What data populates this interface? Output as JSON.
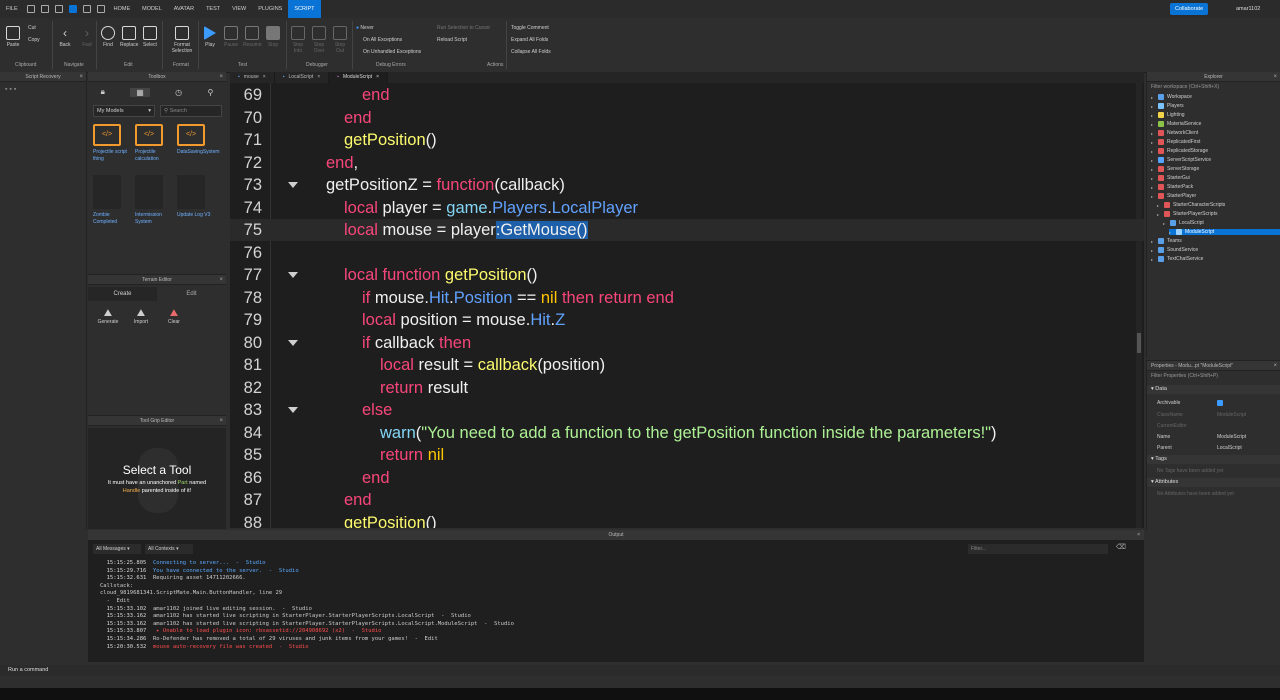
{
  "menu": {
    "items": [
      "FILE",
      "HOME",
      "MODEL",
      "AVATAR",
      "TEST",
      "VIEW",
      "PLUGINS",
      "SCRIPT"
    ],
    "active": "SCRIPT",
    "collaborate": "Collaborate",
    "user": "amar1102"
  },
  "ribbon": {
    "paste": "Paste",
    "cut": "Cut",
    "copy": "Copy",
    "back": "Back",
    "fwd": "Fwd",
    "find": "Find",
    "replace": "Replace",
    "select": "Select",
    "format": "Format Selection",
    "play": "Play",
    "pause": "Pause",
    "resume": "Resume",
    "stop": "Stop",
    "step_into": "Step Into",
    "step_over": "Step Over",
    "step_out": "Step Out",
    "never": "Never",
    "on_all": "On All Exceptions",
    "on_unhandled": "On Unhandled Exceptions",
    "reload": "Reload Script",
    "toggle_comment": "Toggle Comment",
    "expand": "Expand All Folds",
    "collapse": "Collapse All Folds",
    "groups": [
      "Clipboard",
      "Navigate",
      "Edit",
      "Format",
      "Test",
      "Debugger",
      "Debug Errors",
      "Actions"
    ]
  },
  "script_recovery": {
    "title": "Script Recovery"
  },
  "toolbox": {
    "title": "Toolbox",
    "dropdown": "My Models",
    "search_placeholder": "Search",
    "items": [
      "Projectile script thing",
      "Projectile calculation",
      "DataSavingSystem",
      "Zombie Completed",
      "Intermission System",
      "Update Log V3"
    ]
  },
  "terrain": {
    "title": "Terrain Editor",
    "tabs": [
      "Create",
      "Edit"
    ],
    "tools": [
      "Generate",
      "Import",
      "Clear"
    ]
  },
  "toolgrip": {
    "title": "Tool Grip Editor",
    "heading": "Select a Tool",
    "msg_a": "It must have an unanchored",
    "part": "Part",
    "msg_b": "named",
    "handle": "Handle",
    "msg_c": "parented inside of it!"
  },
  "tabs": [
    "mouse",
    "LocalScript",
    "ModuleScript"
  ],
  "active_tab": "ModuleScript",
  "code_lines": [
    {
      "n": "69",
      "fold": false,
      "indent": 3,
      "tokens": [
        [
          "kw",
          "end"
        ]
      ]
    },
    {
      "n": "70",
      "fold": false,
      "indent": 2,
      "tokens": [
        [
          "kw",
          "end"
        ]
      ]
    },
    {
      "n": "71",
      "fold": false,
      "indent": 2,
      "tokens": [
        [
          "fn",
          "getPosition"
        ],
        [
          "tx",
          "()"
        ]
      ]
    },
    {
      "n": "72",
      "fold": false,
      "indent": 1,
      "tokens": [
        [
          "kw",
          "end"
        ],
        [
          "tx",
          ","
        ]
      ]
    },
    {
      "n": "73",
      "fold": true,
      "indent": 1,
      "tokens": [
        [
          "tx",
          "getPositionZ = "
        ],
        [
          "kw",
          "function"
        ],
        [
          "tx",
          "(callback)"
        ]
      ]
    },
    {
      "n": "74",
      "fold": false,
      "indent": 2,
      "tokens": [
        [
          "kw",
          "local"
        ],
        [
          "tx",
          " player = "
        ],
        [
          "bi",
          "game"
        ],
        [
          "tx",
          "."
        ],
        [
          "pr",
          "Players"
        ],
        [
          "tx",
          "."
        ],
        [
          "pr",
          "LocalPlayer"
        ]
      ]
    },
    {
      "n": "75",
      "fold": false,
      "indent": 2,
      "highlight": true,
      "tokens": [
        [
          "kw",
          "local"
        ],
        [
          "tx",
          " mouse = player"
        ],
        [
          "sel",
          ":GetMouse()"
        ]
      ]
    },
    {
      "n": "76",
      "fold": false,
      "indent": 0,
      "tokens": []
    },
    {
      "n": "77",
      "fold": true,
      "indent": 2,
      "tokens": [
        [
          "kw",
          "local function "
        ],
        [
          "fn",
          "getPosition"
        ],
        [
          "tx",
          "()"
        ]
      ]
    },
    {
      "n": "78",
      "fold": false,
      "indent": 3,
      "tokens": [
        [
          "kw",
          "if"
        ],
        [
          "tx",
          " mouse."
        ],
        [
          "pr",
          "Hit"
        ],
        [
          "tx",
          "."
        ],
        [
          "pr",
          "Position"
        ],
        [
          "tx",
          " == "
        ],
        [
          "nl",
          "nil"
        ],
        [
          "kw",
          " then return end"
        ]
      ]
    },
    {
      "n": "79",
      "fold": false,
      "indent": 3,
      "tokens": [
        [
          "kw",
          "local"
        ],
        [
          "tx",
          " position = mouse."
        ],
        [
          "pr",
          "Hit"
        ],
        [
          "tx",
          "."
        ],
        [
          "pr",
          "Z"
        ]
      ]
    },
    {
      "n": "80",
      "fold": true,
      "indent": 3,
      "tokens": [
        [
          "kw",
          "if"
        ],
        [
          "tx",
          " callback "
        ],
        [
          "kw",
          "then"
        ]
      ]
    },
    {
      "n": "81",
      "fold": false,
      "indent": 4,
      "tokens": [
        [
          "kw",
          "local"
        ],
        [
          "tx",
          " result = "
        ],
        [
          "fn",
          "callback"
        ],
        [
          "tx",
          "(position)"
        ]
      ]
    },
    {
      "n": "82",
      "fold": false,
      "indent": 4,
      "tokens": [
        [
          "kw",
          "return"
        ],
        [
          "tx",
          " result"
        ]
      ]
    },
    {
      "n": "83",
      "fold": true,
      "indent": 3,
      "tokens": [
        [
          "kw",
          "else"
        ]
      ]
    },
    {
      "n": "84",
      "fold": false,
      "indent": 4,
      "tokens": [
        [
          "bi",
          "warn"
        ],
        [
          "tx",
          "("
        ],
        [
          "st",
          "\"You need to add a function to the getPosition function inside the parameters!\""
        ],
        [
          "tx",
          ")"
        ]
      ]
    },
    {
      "n": "85",
      "fold": false,
      "indent": 4,
      "tokens": [
        [
          "kw",
          "return"
        ],
        [
          "tx",
          " "
        ],
        [
          "nl",
          "nil"
        ]
      ]
    },
    {
      "n": "86",
      "fold": false,
      "indent": 3,
      "tokens": [
        [
          "kw",
          "end"
        ]
      ]
    },
    {
      "n": "87",
      "fold": false,
      "indent": 2,
      "tokens": [
        [
          "kw",
          "end"
        ]
      ]
    },
    {
      "n": "88",
      "fold": false,
      "indent": 2,
      "tokens": [
        [
          "fn",
          "getPosition"
        ],
        [
          "tx",
          "()"
        ]
      ]
    }
  ],
  "explorer": {
    "title": "Explorer",
    "filter": "Filter workspace (Ctrl+Shift+X)",
    "items": [
      {
        "label": "Workspace",
        "depth": 0,
        "color": "#5aa0e8"
      },
      {
        "label": "Players",
        "depth": 0,
        "color": "#7bc4ff"
      },
      {
        "label": "Lighting",
        "depth": 0,
        "color": "#f2d34a"
      },
      {
        "label": "MaterialService",
        "depth": 0,
        "color": "#8bc34a"
      },
      {
        "label": "NetworkClient",
        "depth": 0,
        "color": "#e05555"
      },
      {
        "label": "ReplicatedFirst",
        "depth": 0,
        "color": "#e05555"
      },
      {
        "label": "ReplicatedStorage",
        "depth": 0,
        "color": "#e05555"
      },
      {
        "label": "ServerScriptService",
        "depth": 0,
        "color": "#57a4ff"
      },
      {
        "label": "ServerStorage",
        "depth": 0,
        "color": "#e05555"
      },
      {
        "label": "StarterGui",
        "depth": 0,
        "color": "#e05555"
      },
      {
        "label": "StarterPack",
        "depth": 0,
        "color": "#e05555"
      },
      {
        "label": "StarterPlayer",
        "depth": 0,
        "color": "#e05555"
      },
      {
        "label": "StarterCharacterScripts",
        "depth": 1,
        "color": "#e05555"
      },
      {
        "label": "StarterPlayerScripts",
        "depth": 1,
        "color": "#e05555"
      },
      {
        "label": "LocalScript",
        "depth": 2,
        "color": "#5aa0e8"
      },
      {
        "label": "ModuleScript",
        "depth": 3,
        "color": "#9ad0ff",
        "selected": true
      },
      {
        "label": "Teams",
        "depth": 0,
        "color": "#5aa0e8"
      },
      {
        "label": "SoundService",
        "depth": 0,
        "color": "#5aa0e8"
      },
      {
        "label": "TextChatService",
        "depth": 0,
        "color": "#5aa0e8"
      }
    ]
  },
  "properties": {
    "title": "Properties - Modu...pt \"ModuleScript\"",
    "filter": "Filter Properties (Ctrl+Shift+P)",
    "section_data": "Data",
    "archivable": "Archivable",
    "classname": "ClassName",
    "classname_val": "ModuleScript",
    "current": "CurrentEditor",
    "name": "Name",
    "name_val": "ModuleScript",
    "parent": "Parent",
    "parent_val": "LocalScript",
    "section_tags": "Tags",
    "no_tags": "No Tags have been added yet",
    "section_attrs": "Attributes",
    "no_attrs": "No Attributes have been added yet"
  },
  "output": {
    "title": "Output",
    "filter1": "All Messages",
    "filter2": "All Contexts",
    "filter_placeholder": "Filter...",
    "lines": [
      {
        "t": "  15:15:25.805  ",
        "c": "ob",
        "m": "Connecting to server...  -  Studio"
      },
      {
        "t": "  15:15:29.716  ",
        "c": "ob",
        "m": "You have connected to the server.  -  Studio"
      },
      {
        "t": "  15:15:32.631  ",
        "c": "ot",
        "m": "Requiring asset 14711202666."
      },
      {
        "t": "",
        "c": "ot",
        "m": "Callstack:"
      },
      {
        "t": "",
        "c": "ot",
        "m": "cloud_9819681341.ScriptMate.Main.ButtonHandler, line 29"
      },
      {
        "t": "",
        "c": "ot",
        "m": "  -  Edit"
      },
      {
        "t": "  15:15:33.102  ",
        "c": "ot",
        "m": "amar1102 joined live editing session.  -  Studio"
      },
      {
        "t": "  15:15:33.162  ",
        "c": "ot",
        "m": "amar1102 has started live scripting in StarterPlayer.StarterPlayerScripts.LocalScript  -  Studio"
      },
      {
        "t": "  15:15:33.162  ",
        "c": "ot",
        "m": "amar1102 has started live scripting in StarterPlayer.StarterPlayerScripts.LocalScript.ModuleScript  -  Studio"
      },
      {
        "t": "  15:15:33.807  ",
        "c": "or",
        "m": " ▸ Unable to load plugin icon: rbxassetid://204908692 (x2)  -  Studio"
      },
      {
        "t": "  15:15:34.286  ",
        "c": "ot",
        "m": "Ro-Defender has removed a total of 29 viruses and junk items from your games!  -  Edit"
      },
      {
        "t": "  15:20:30.532  ",
        "c": "or",
        "m": "mouse auto-recovery file was created  -  Studio"
      }
    ]
  },
  "command_bar": "Run a command"
}
